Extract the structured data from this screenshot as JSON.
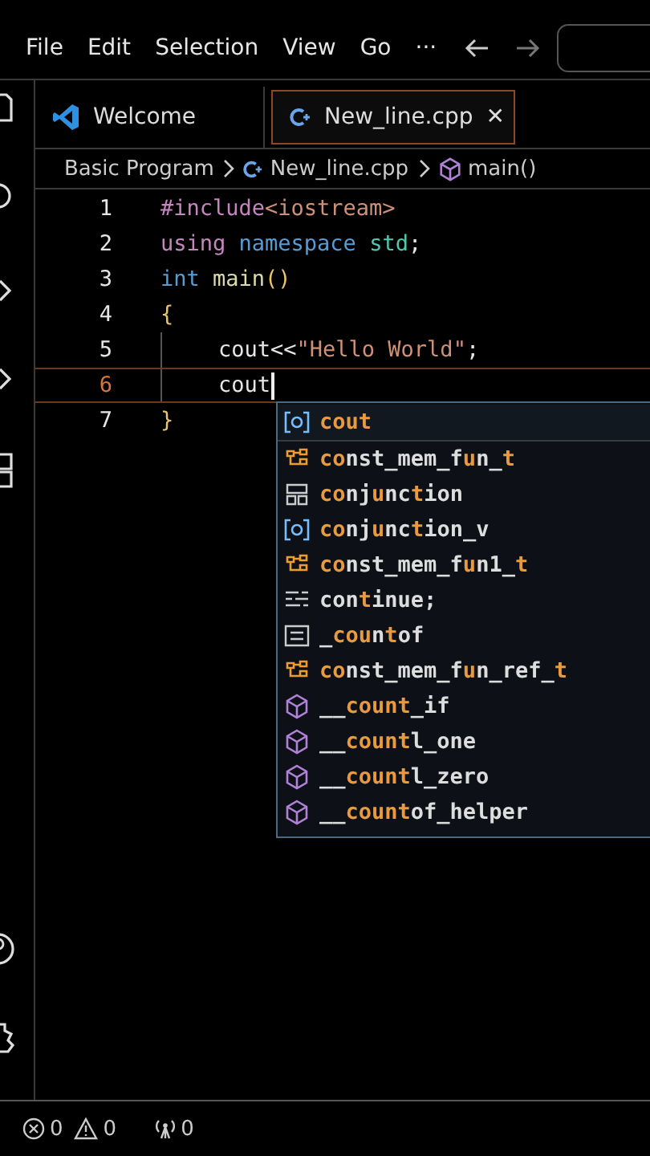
{
  "menu": [
    "File",
    "Edit",
    "Selection",
    "View",
    "Go",
    "···"
  ],
  "tabs": [
    {
      "label": "Welcome",
      "kind": "welcome",
      "selected": false,
      "closable": false
    },
    {
      "label": "New_line.cpp",
      "kind": "cpp",
      "selected": true,
      "closable": true
    }
  ],
  "close_glyph": "✕",
  "breadcrumb": [
    {
      "label": "Basic Program",
      "kind": "folder"
    },
    {
      "label": "New_line.cpp",
      "kind": "cpp"
    },
    {
      "label": "main()",
      "kind": "method"
    }
  ],
  "code_lines": [
    {
      "number": "1",
      "current": false,
      "indent": false,
      "tokens": [
        {
          "text": "#include",
          "kind": "directive"
        },
        {
          "text": "<iostream>",
          "kind": "string"
        }
      ]
    },
    {
      "number": "2",
      "current": false,
      "indent": false,
      "tokens": [
        {
          "text": "using ",
          "kind": "control"
        },
        {
          "text": "namespace ",
          "kind": "keyword"
        },
        {
          "text": "std",
          "kind": "type"
        },
        {
          "text": ";",
          "kind": "plain"
        }
      ]
    },
    {
      "number": "3",
      "current": false,
      "indent": false,
      "tokens": [
        {
          "text": "int ",
          "kind": "keyword"
        },
        {
          "text": "main",
          "kind": "function"
        },
        {
          "text": "()",
          "kind": "brace"
        }
      ]
    },
    {
      "number": "4",
      "current": false,
      "indent": false,
      "tokens": [
        {
          "text": "{",
          "kind": "brace"
        }
      ]
    },
    {
      "number": "5",
      "current": false,
      "indent": true,
      "tokens": [
        {
          "text": "cout",
          "kind": "plain"
        },
        {
          "text": "<<",
          "kind": "plain"
        },
        {
          "text": "\"Hello World\"",
          "kind": "string"
        },
        {
          "text": ";",
          "kind": "plain"
        }
      ]
    },
    {
      "number": "6",
      "current": true,
      "indent": true,
      "tokens": [
        {
          "text": "cout",
          "kind": "plain"
        }
      ]
    },
    {
      "number": "7",
      "current": false,
      "indent": false,
      "tokens": [
        {
          "text": "}",
          "kind": "brace"
        }
      ]
    }
  ],
  "suggestions": [
    {
      "label": "**cout**",
      "kind": "variable",
      "selected": true
    },
    {
      "label": "**co**nst_mem_f**u**n_**t**",
      "kind": "class",
      "selected": false
    },
    {
      "label": "**co**nj**u**nc**t**ion",
      "kind": "struct",
      "selected": false
    },
    {
      "label": "**co**nj**u**nc**t**ion_v",
      "kind": "variable",
      "selected": false
    },
    {
      "label": "**co**nst_mem_f**u**n1_**t**",
      "kind": "class",
      "selected": false
    },
    {
      "label": "con**t**inue;",
      "kind": "keyword",
      "selected": false
    },
    {
      "label": "_**cou**n**t**of",
      "kind": "snippet",
      "selected": false
    },
    {
      "label": "**co**nst_mem_f**u**n_ref_**t**",
      "kind": "class",
      "selected": false
    },
    {
      "label": "__**count**_if",
      "kind": "method",
      "selected": false
    },
    {
      "label": "__**count**l_one",
      "kind": "method",
      "selected": false
    },
    {
      "label": "__**count**l_zero",
      "kind": "method",
      "selected": false
    },
    {
      "label": "__**count**of_helper",
      "kind": "method",
      "selected": false
    }
  ],
  "status_bar": {
    "errors": "0",
    "warnings": "0",
    "ports": "0"
  }
}
